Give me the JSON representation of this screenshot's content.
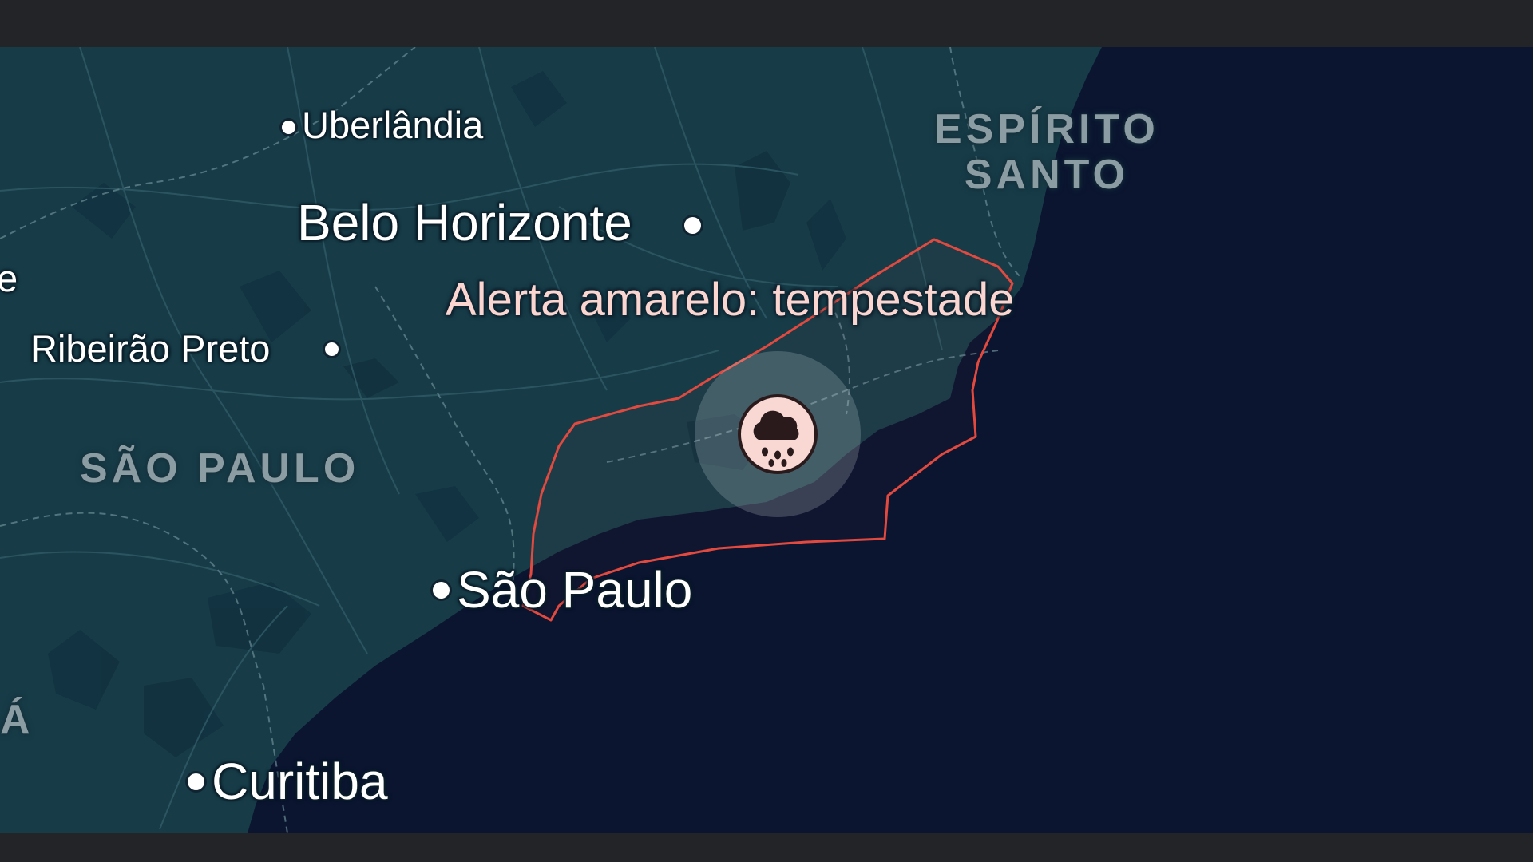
{
  "map": {
    "colors": {
      "land": "#173c48",
      "ocean": "#0b1530",
      "frame": "#232427",
      "alert_outline": "#e2493f",
      "alert_badge": "#f9d7d2",
      "alert_halo": "#cfd9dc"
    },
    "states": {
      "espirito_santo": "ESPÍRITO\nSANTO",
      "sao_paulo": "SÃO PAULO",
      "parana_partial": "Á",
      "partial_left": "e"
    },
    "cities": {
      "uberlandia": "Uberlândia",
      "belo_horizonte": "Belo Horizonte",
      "ribeirao_preto": "Ribeirão Preto",
      "sao_paulo": "São Paulo",
      "curitiba": "Curitiba"
    },
    "alert": {
      "label": "Alerta amarelo: tempestade",
      "icon": "storm-rain-icon"
    }
  }
}
